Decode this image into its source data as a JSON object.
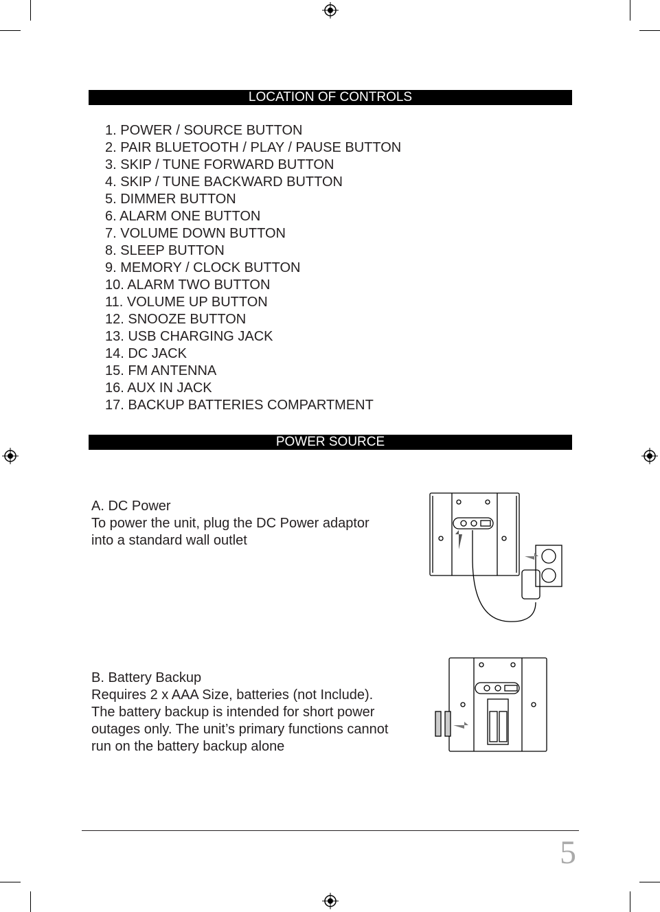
{
  "sections": {
    "controls": {
      "title": "LOCATION OF CONTROLS",
      "items": [
        "1. POWER / SOURCE BUTTON",
        "2. PAIR BLUETOOTH / PLAY / PAUSE BUTTON",
        "3. SKIP / TUNE FORWARD BUTTON",
        "4. SKIP / TUNE BACKWARD BUTTON",
        "5. DIMMER BUTTON",
        "6. ALARM ONE BUTTON",
        "7. VOLUME DOWN BUTTON",
        "8. SLEEP BUTTON",
        "9. MEMORY / CLOCK BUTTON",
        "10. ALARM TWO BUTTON",
        "11. VOLUME UP BUTTON",
        "12. SNOOZE BUTTON",
        "13. USB CHARGING JACK",
        "14. DC JACK",
        "15. FM ANTENNA",
        "16. AUX IN JACK",
        "17. BACKUP BATTERIES COMPARTMENT"
      ]
    },
    "power": {
      "title": "POWER SOURCE",
      "dc": {
        "heading": "A. DC Power",
        "lines": [
          "To power the unit, plug the DC Power adaptor",
          "into a standard wall outlet"
        ]
      },
      "battery": {
        "heading": "B. Battery Backup",
        "lines": [
          "Requires 2 x AAA Size, batteries (not Include).",
          "The battery backup is intended for short power",
          "outages only. The unit’s primary functions cannot",
          "run on the battery backup alone"
        ]
      }
    }
  },
  "page_number": "5"
}
